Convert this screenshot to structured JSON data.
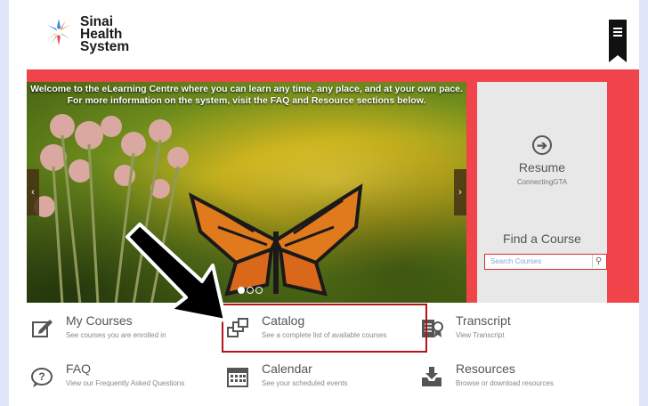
{
  "header": {
    "logo_line1": "Sinai",
    "logo_line2": "Health",
    "logo_line3": "System",
    "menu_icon": "menu-icon"
  },
  "hero": {
    "caption_line1": "Welcome to the eLearning Centre where you can learn any time, any place, and at your own pace.",
    "caption_line2": "For more information on the system, visit the FAQ and Resource sections below.",
    "prev_glyph": "‹",
    "next_glyph": "›",
    "slide_count": 3,
    "active_slide": 1
  },
  "side_panel": {
    "resume_icon_glyph": "➔",
    "resume_title": "Resume",
    "resume_sub": "ConnectingGTA",
    "find_title": "Find a Course",
    "search_placeholder": "Search Courses",
    "search_icon_glyph": "⚲"
  },
  "tiles": [
    {
      "title": "My Courses",
      "sub": "See courses you are enrolled in",
      "icon": "edit-icon"
    },
    {
      "title": "Catalog",
      "sub": "See a complete list of available courses",
      "icon": "windows-icon"
    },
    {
      "title": "Transcript",
      "sub": "View Transcript",
      "icon": "transcript-icon"
    },
    {
      "title": "FAQ",
      "sub": "View our Frequently Asked Questions",
      "icon": "question-bubble-icon"
    },
    {
      "title": "Calendar",
      "sub": "See your scheduled events",
      "icon": "calendar-icon"
    },
    {
      "title": "Resources",
      "sub": "Browse or download resources",
      "icon": "download-tray-icon"
    }
  ],
  "colors": {
    "accent_red": "#f0434a",
    "highlight_red": "#b3151c",
    "side_panel_bg": "#e8e8e8"
  }
}
